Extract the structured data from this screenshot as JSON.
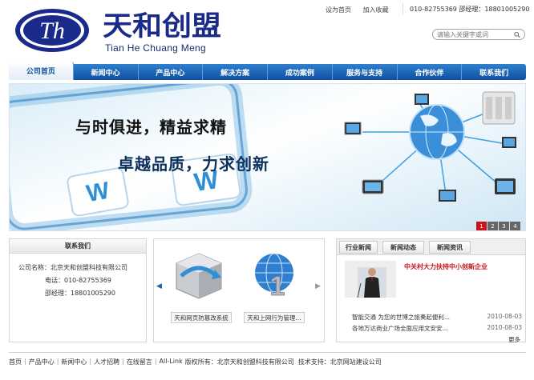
{
  "brand": {
    "name_cn": "天和创盟",
    "name_en": "Tian He Chuang Meng",
    "logo_letter": "Th",
    "primary_color": "#1a2a8a",
    "accent_color": "#0f4f9e"
  },
  "top_links": {
    "home": "设为首页",
    "favorite": "加入收藏"
  },
  "contact_top": {
    "text": "010-82755369  邵经理：18801005290"
  },
  "search": {
    "placeholder": "请输入关键字或词"
  },
  "nav": {
    "items": [
      {
        "label": "公司首页",
        "active": true
      },
      {
        "label": "新闻中心"
      },
      {
        "label": "产品中心"
      },
      {
        "label": "解决方案"
      },
      {
        "label": "成功案例"
      },
      {
        "label": "服务与支持"
      },
      {
        "label": "合作伙伴"
      },
      {
        "label": "联系我们"
      }
    ]
  },
  "banner": {
    "slogan1": "与时俱进，精益求精",
    "slogan2": "卓越品质，力求创新",
    "pages": [
      "1",
      "2",
      "3",
      "4"
    ],
    "current_page": "1"
  },
  "contact_box": {
    "title": "联系我们",
    "company": "公司名称：北京天和创盟科技有限公司",
    "phone": "电话：010-82755369",
    "manager": "邵经理：18801005290"
  },
  "products": {
    "prev": "◀",
    "next": "▶",
    "items": [
      {
        "label": "天和网页防篡改系统"
      },
      {
        "label": "天和上网行为管理..."
      }
    ]
  },
  "news": {
    "tabs": [
      "行业新闻",
      "新闻动态",
      "新闻资讯"
    ],
    "headline": "中关村大力扶持中小创新企业",
    "rows": [
      {
        "title": "智能交通 为您的世博之旅奏起便利...",
        "date": "2010-08-03"
      },
      {
        "title": "各地万达商业广场全面应用文安安...",
        "date": "2010-08-03"
      }
    ],
    "more": "更多"
  },
  "footer": {
    "links": [
      "首页",
      "产品中心",
      "新闻中心",
      "人才招聘",
      "在线留言",
      "All-Link"
    ],
    "copyright": "版权所有：北京天和创盟科技有限公司",
    "support": "技术支持：北京网站建设公司"
  }
}
